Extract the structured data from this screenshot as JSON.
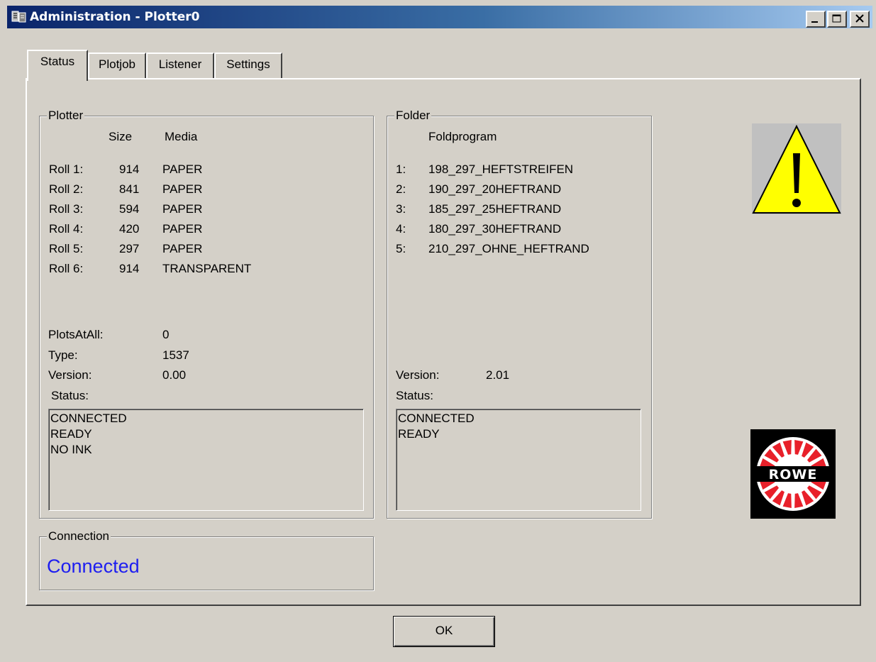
{
  "window": {
    "title": "Administration - Plotter0"
  },
  "tabs": [
    {
      "label": "Status",
      "active": true
    },
    {
      "label": "Plotjob",
      "active": false
    },
    {
      "label": "Listener",
      "active": false
    },
    {
      "label": "Settings",
      "active": false
    }
  ],
  "plotter": {
    "legend": "Plotter",
    "col_size": "Size",
    "col_media": "Media",
    "rolls": [
      {
        "label": "Roll 1:",
        "size": "914",
        "media": "PAPER"
      },
      {
        "label": "Roll 2:",
        "size": "841",
        "media": "PAPER"
      },
      {
        "label": "Roll 3:",
        "size": "594",
        "media": "PAPER"
      },
      {
        "label": "Roll 4:",
        "size": "420",
        "media": "PAPER"
      },
      {
        "label": "Roll 5:",
        "size": "297",
        "media": "PAPER"
      },
      {
        "label": "Roll 6:",
        "size": "914",
        "media": "TRANSPARENT"
      }
    ],
    "plots_at_all_label": "PlotsAtAll:",
    "plots_at_all_value": "0",
    "type_label": "Type:",
    "type_value": "1537",
    "version_label": "Version:",
    "version_value": "0.00",
    "status_label": "Status:",
    "status_lines": [
      "CONNECTED",
      "READY",
      "NO INK"
    ]
  },
  "folder": {
    "legend": "Folder",
    "col_foldprogram": "Foldprogram",
    "programs": [
      {
        "num": "1:",
        "name": "198_297_HEFTSTREIFEN"
      },
      {
        "num": "2:",
        "name": "190_297_20HEFTRAND"
      },
      {
        "num": "3:",
        "name": "185_297_25HEFTRAND"
      },
      {
        "num": "4:",
        "name": "180_297_30HEFTRAND"
      },
      {
        "num": "5:",
        "name": "210_297_OHNE_HEFTRAND"
      }
    ],
    "version_label": "Version:",
    "version_value": "2.01",
    "status_label": "Status:",
    "status_lines": [
      "CONNECTED",
      "READY"
    ]
  },
  "connection": {
    "legend": "Connection",
    "state": "Connected"
  },
  "icons": {
    "app": "app-icon",
    "warning": "warning-icon",
    "logo": "rowe-logo",
    "logo_text": "ROWE"
  },
  "colors": {
    "connected_text": "#1e1ef0",
    "warning_fill": "#ffff00",
    "titlebar_start": "#0a246a"
  },
  "buttons": {
    "ok": "OK"
  }
}
